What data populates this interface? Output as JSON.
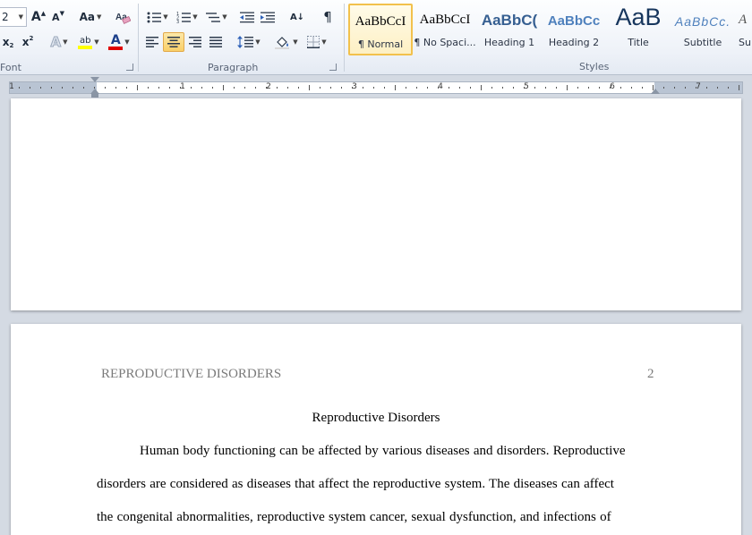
{
  "ribbon": {
    "font_group": {
      "label": "Font",
      "size_value": "2",
      "grow_label": "A",
      "shrink_label": "A",
      "case_label": "Aa",
      "subscript_label": "x",
      "superscript_label": "x",
      "effects_label": "A",
      "highlight_label": "ab",
      "color_label": "A",
      "highlight_color": "#ffff00",
      "font_color": "#e00000"
    },
    "paragraph_group": {
      "label": "Paragraph",
      "pilcrow": "¶",
      "sort_label": "A↓"
    },
    "styles_group": {
      "label": "Styles",
      "styles": [
        {
          "preview": "AaBbCcI",
          "name": "¶ Normal"
        },
        {
          "preview": "AaBbCcI",
          "name": "¶ No Spaci..."
        },
        {
          "preview": "AaBbC(",
          "name": "Heading 1"
        },
        {
          "preview": "AaBbCc",
          "name": "Heading 2"
        },
        {
          "preview": "AaB",
          "name": "Title"
        },
        {
          "preview": "AaBbCc.",
          "name": "Subtitle"
        },
        {
          "preview": "A",
          "name": "Su"
        }
      ]
    }
  },
  "ruler": {
    "numbers": [
      "1",
      "1",
      "2",
      "3",
      "4",
      "5",
      "6",
      "7"
    ]
  },
  "document": {
    "header_title": "REPRODUCTIVE DISORDERS",
    "page_number": "2",
    "title": "Reproductive Disorders",
    "lines": [
      "Human body functioning can be affected by various diseases and disorders. Reproductive",
      "disorders are considered as diseases that affect the reproductive system. The diseases can affect",
      "the congenital abnormalities, reproductive system cancer, sexual dysfunction, and infections of"
    ]
  }
}
